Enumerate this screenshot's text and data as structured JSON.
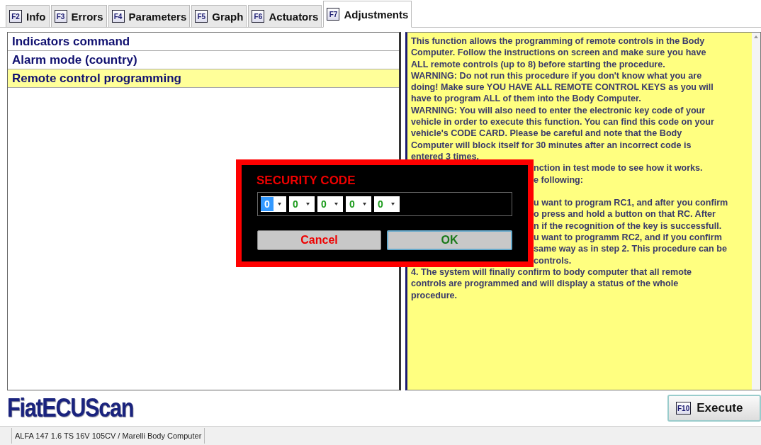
{
  "tabs": [
    {
      "key": "F2",
      "label": "Info",
      "selected": false
    },
    {
      "key": "F3",
      "label": "Errors",
      "selected": false
    },
    {
      "key": "F4",
      "label": "Parameters",
      "selected": false
    },
    {
      "key": "F5",
      "label": "Graph",
      "selected": false
    },
    {
      "key": "F6",
      "label": "Actuators",
      "selected": false
    },
    {
      "key": "F7",
      "label": "Adjustments",
      "selected": true
    }
  ],
  "functions": [
    {
      "label": "Indicators command",
      "selected": false
    },
    {
      "label": "Alarm mode (country)",
      "selected": false
    },
    {
      "label": "Remote control programming",
      "selected": true
    }
  ],
  "description": [
    {
      "kind": "full",
      "text": "This function allows the programming of remote controls in the Body"
    },
    {
      "kind": "full",
      "text": "Computer. Follow the instructions on screen and make sure you have"
    },
    {
      "kind": "full",
      "text": "ALL remote controls (up to 8) before starting the procedure."
    },
    {
      "kind": "full",
      "text": "WARNING: Do not run this procedure if you don't know what you are"
    },
    {
      "kind": "full",
      "text": "doing! Make sure YOU HAVE ALL REMOTE CONTROL KEYS as you will"
    },
    {
      "kind": "full",
      "text": "have to program ALL of them into the Body Computer."
    },
    {
      "kind": "full",
      "text": "WARNING: You will also need to enter the electronic key code of your"
    },
    {
      "kind": "full",
      "text": "vehicle in order to execute this function. You can find this code on your"
    },
    {
      "kind": "full",
      "text": "vehicle's CODE CARD. Please be careful and note that the Body"
    },
    {
      "kind": "full",
      "text": "Computer will block itself for 30 minutes after an incorrect code is"
    },
    {
      "kind": "full",
      "text": "entered 3 times."
    },
    {
      "kind": "partial",
      "text": "nction in test mode to see how it works."
    },
    {
      "kind": "partial",
      "text": "e following:"
    },
    {
      "kind": "partial_after_gap",
      "text": "u want to program RC1, and after you confirm"
    },
    {
      "kind": "partial",
      "text": "o press and hold a button on that RC. After"
    },
    {
      "kind": "partial",
      "text": "n if the recognition of the key is successfull."
    },
    {
      "kind": "partial",
      "text": "u want to programm RC2, and if you confirm"
    },
    {
      "kind": "partial",
      "text": "same way as in step 2. This procedure can be"
    },
    {
      "kind": "partial",
      "text": "controls."
    },
    {
      "kind": "full",
      "text": "4. The system will finally confirm to body computer that all remote"
    },
    {
      "kind": "full",
      "text": "controls are programmed and will display a status of the whole"
    },
    {
      "kind": "full",
      "text": "procedure."
    }
  ],
  "logo": "FiatECUScan",
  "execute_button": {
    "key": "F10",
    "label": "Execute"
  },
  "status_bar": "ALFA 147 1.6 TS 16V 105CV / Marelli Body Computer",
  "dialog": {
    "title": "SECURITY CODE",
    "digits": [
      {
        "value": "0",
        "selected": true
      },
      {
        "value": "0",
        "selected": false
      },
      {
        "value": "0",
        "selected": false
      },
      {
        "value": "0",
        "selected": false
      },
      {
        "value": "0",
        "selected": false
      }
    ],
    "cancel": "Cancel",
    "ok": "OK"
  }
}
